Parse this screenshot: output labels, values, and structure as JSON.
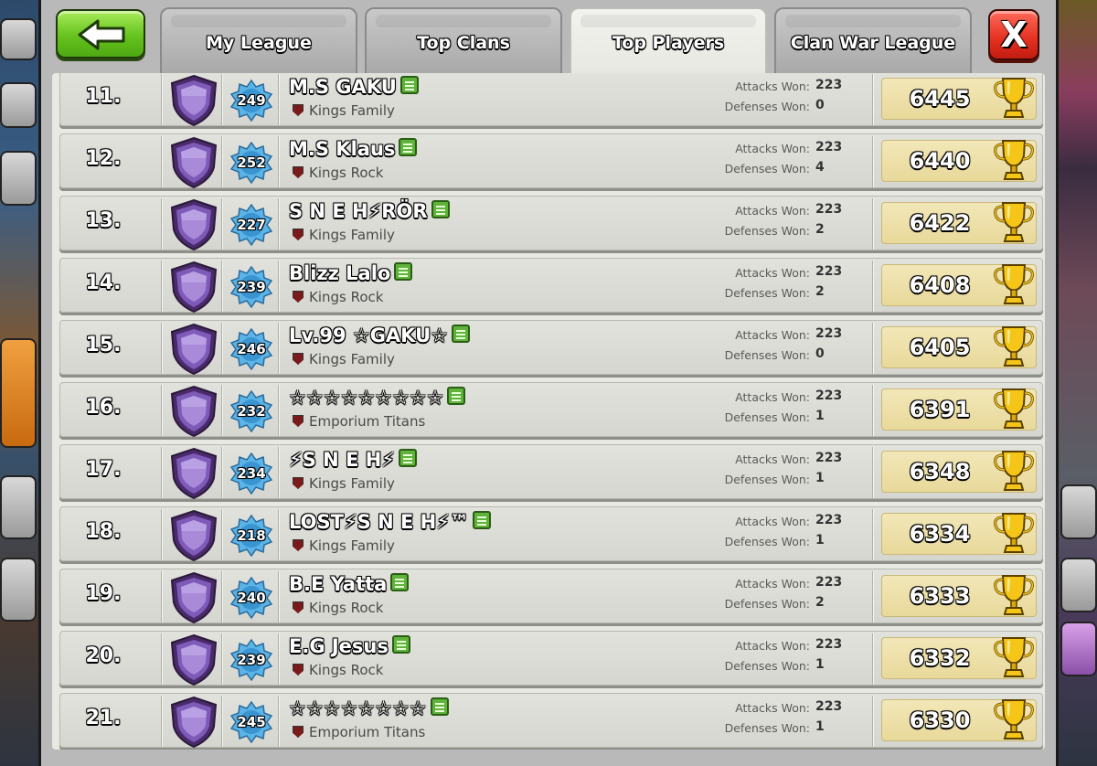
{
  "tabs": [
    {
      "label": "My League",
      "active": false
    },
    {
      "label": "Top Clans",
      "active": false
    },
    {
      "label": "Top Players",
      "active": true
    },
    {
      "label": "Clan War League",
      "active": false
    }
  ],
  "close_label": "X",
  "stat_labels": {
    "attacks": "Attacks Won:",
    "defenses": "Defenses Won:"
  },
  "colors": {
    "back_button": "#66c21e",
    "close_button": "#e43020",
    "trophy_box": "#e8d99a",
    "league_badge": "#5b3a8e"
  },
  "icons": {
    "back": "arrow-left-icon",
    "chat": "chat-icon",
    "trophy": "trophy-icon",
    "league": "legend-league-shield-icon",
    "xp": "xp-star-icon"
  },
  "players": [
    {
      "rank": "11.",
      "level": "249",
      "name": "M.S GAKU",
      "clan": "Kings Family",
      "attacks": "223",
      "defenses": "0",
      "trophies": "6445"
    },
    {
      "rank": "12.",
      "level": "252",
      "name": "M.S Klaus",
      "clan": "Kings Rock",
      "attacks": "223",
      "defenses": "4",
      "trophies": "6440"
    },
    {
      "rank": "13.",
      "level": "227",
      "name": "S N E H⚡RÖR",
      "clan": "Kings Family",
      "attacks": "223",
      "defenses": "2",
      "trophies": "6422"
    },
    {
      "rank": "14.",
      "level": "239",
      "name": "Blizz Lalo",
      "clan": "Kings Rock",
      "attacks": "223",
      "defenses": "2",
      "trophies": "6408"
    },
    {
      "rank": "15.",
      "level": "246",
      "name": "Lv.99 ☆GAKU☆",
      "clan": "Kings Family",
      "attacks": "223",
      "defenses": "0",
      "trophies": "6405"
    },
    {
      "rank": "16.",
      "level": "232",
      "name": "☆☆☆☆☆☆☆☆☆",
      "clan": "Emporium Titans",
      "attacks": "223",
      "defenses": "1",
      "trophies": "6391"
    },
    {
      "rank": "17.",
      "level": "234",
      "name": "⚡S N E H⚡",
      "clan": "Kings Family",
      "attacks": "223",
      "defenses": "1",
      "trophies": "6348"
    },
    {
      "rank": "18.",
      "level": "218",
      "name": "LOST⚡S N E H⚡™",
      "clan": "Kings Family",
      "attacks": "223",
      "defenses": "1",
      "trophies": "6334"
    },
    {
      "rank": "19.",
      "level": "240",
      "name": "B.E Yatta",
      "clan": "Kings Rock",
      "attacks": "223",
      "defenses": "2",
      "trophies": "6333"
    },
    {
      "rank": "20.",
      "level": "239",
      "name": "E.G Jesus",
      "clan": "Kings Rock",
      "attacks": "223",
      "defenses": "1",
      "trophies": "6332"
    },
    {
      "rank": "21.",
      "level": "245",
      "name": "☆☆☆☆☆☆☆☆",
      "clan": "Emporium Titans",
      "attacks": "223",
      "defenses": "1",
      "trophies": "6330"
    }
  ]
}
